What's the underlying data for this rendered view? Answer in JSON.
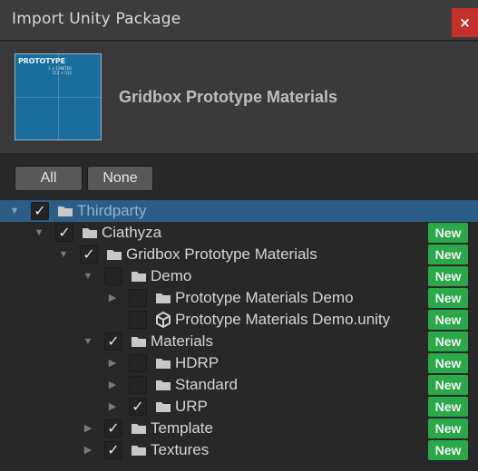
{
  "window": {
    "title": "Import Unity Package",
    "close_glyph": "×"
  },
  "package": {
    "name": "Gridbox Prototype Materials",
    "thumbnail": {
      "title": "PROTOTYPE",
      "line1": "1 × 1 METER",
      "line2": "512 × 512"
    }
  },
  "buttons": {
    "all": "All",
    "none": "None"
  },
  "colors": {
    "selected_row": "#2c5d87",
    "new_badge": "#2ba84a",
    "close_button": "#c4302b"
  },
  "tree": {
    "new_badge": "New",
    "check_glyph": "✓",
    "items": [
      {
        "label": "Thirdparty",
        "checked": true,
        "expanded": true,
        "has_arrow": true,
        "icon": "folder-icon",
        "badge": false,
        "selected": true
      },
      {
        "label": "Ciathyza",
        "checked": true,
        "expanded": true,
        "has_arrow": true,
        "icon": "folder-icon",
        "badge": true
      },
      {
        "label": "Gridbox Prototype Materials",
        "checked": true,
        "expanded": true,
        "has_arrow": true,
        "icon": "folder-icon",
        "badge": true
      },
      {
        "label": "Demo",
        "checked": false,
        "expanded": true,
        "has_arrow": true,
        "icon": "folder-icon",
        "badge": true
      },
      {
        "label": "Prototype Materials Demo",
        "checked": false,
        "expanded": false,
        "has_arrow": true,
        "icon": "folder-icon",
        "badge": true
      },
      {
        "label": "Prototype Materials Demo.unity",
        "checked": false,
        "expanded": false,
        "has_arrow": false,
        "icon": "unity-scene-icon",
        "badge": true
      },
      {
        "label": "Materials",
        "checked": true,
        "expanded": true,
        "has_arrow": true,
        "icon": "folder-icon",
        "badge": true
      },
      {
        "label": "HDRP",
        "checked": false,
        "expanded": false,
        "has_arrow": true,
        "icon": "folder-icon",
        "badge": true
      },
      {
        "label": "Standard",
        "checked": false,
        "expanded": false,
        "has_arrow": true,
        "icon": "folder-icon",
        "badge": true
      },
      {
        "label": "URP",
        "checked": true,
        "expanded": false,
        "has_arrow": true,
        "icon": "folder-icon",
        "badge": true
      },
      {
        "label": "Template",
        "checked": true,
        "expanded": false,
        "has_arrow": true,
        "icon": "folder-icon",
        "badge": true
      },
      {
        "label": "Textures",
        "checked": true,
        "expanded": false,
        "has_arrow": true,
        "icon": "folder-icon",
        "badge": true
      }
    ]
  }
}
